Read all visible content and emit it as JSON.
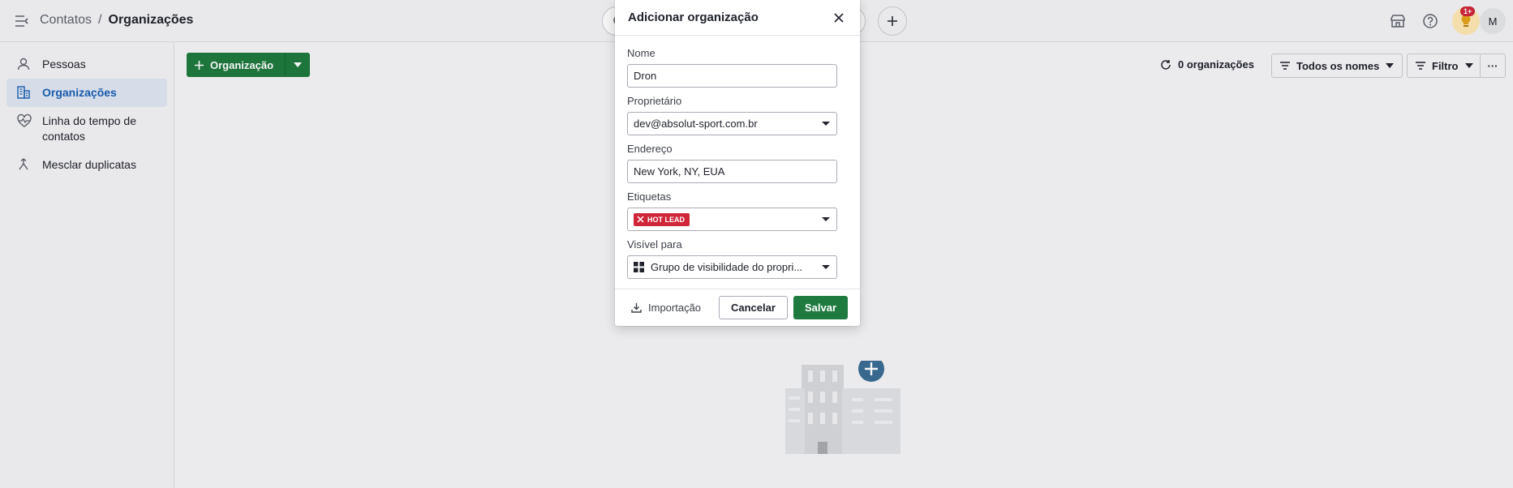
{
  "breadcrumb": {
    "parent": "Contatos",
    "separator": "/",
    "current": "Organizações"
  },
  "topbar": {
    "notification_badge": "1+",
    "avatar_initial": "M"
  },
  "sidebar": {
    "items": [
      {
        "label": "Pessoas",
        "icon": "person-icon"
      },
      {
        "label": "Organizações",
        "icon": "building-icon",
        "active": true
      },
      {
        "label": "Linha do tempo de contatos",
        "icon": "heart-pulse-icon"
      },
      {
        "label": "Mesclar duplicatas",
        "icon": "merge-icon"
      }
    ]
  },
  "main": {
    "add_button_label": "Organização",
    "count_label": "0 organizações",
    "names_filter_label": "Todos os nomes",
    "filter_label": "Filtro",
    "more_label": "···"
  },
  "modal": {
    "title": "Adicionar organização",
    "fields": {
      "name": {
        "label": "Nome",
        "value": "Dron"
      },
      "owner": {
        "label": "Proprietário",
        "value": "dev@absolut-sport.com.br"
      },
      "address": {
        "label": "Endereço",
        "value": "New York, NY, EUA"
      },
      "tags": {
        "label": "Etiquetas",
        "chip": "HOT LEAD"
      },
      "visibility": {
        "label": "Visível para",
        "value": "Grupo de visibilidade do propri..."
      }
    },
    "footer": {
      "import_label": "Importação",
      "cancel_label": "Cancelar",
      "save_label": "Salvar"
    }
  },
  "colors": {
    "primary_green": "#1f7a3f",
    "active_blue": "#1a5fb4",
    "tag_red": "#d0263a"
  }
}
